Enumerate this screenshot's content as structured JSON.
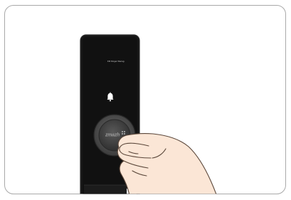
{
  "scene": {
    "subject": "smart-door-lock",
    "device_display_text": "Fill Finger Recog.",
    "icon": "bell-icon",
    "button_logo_text": "zmazh",
    "colors": {
      "device_body": "#171717",
      "device_edge": "#2a2a2a",
      "button_ring": "#5c5c5c",
      "button_face": "#3e3e3e",
      "skin": "#fbe6d6",
      "skin_outline": "#5a4639",
      "card_border": "#a9a9a9"
    }
  }
}
